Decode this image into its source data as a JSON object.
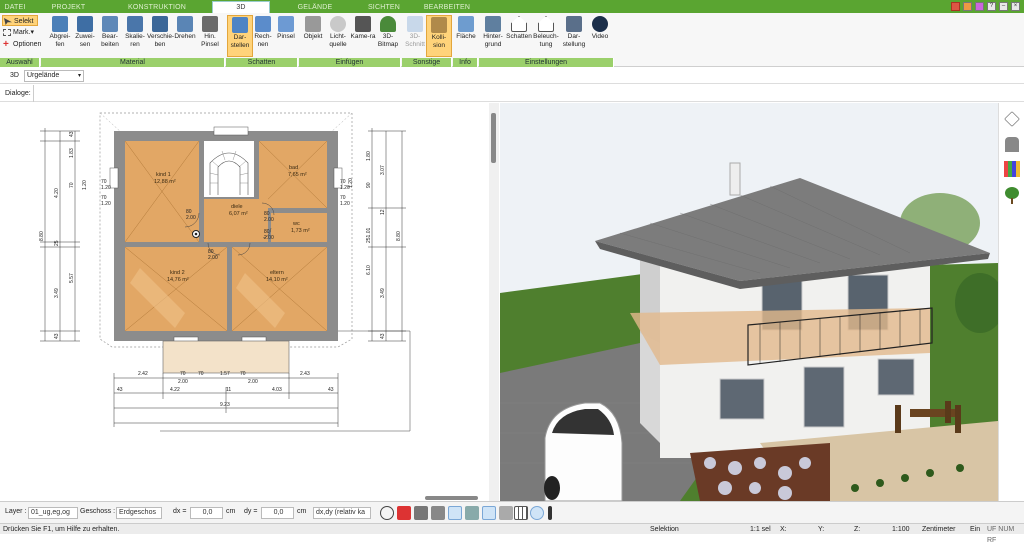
{
  "tabs": [
    {
      "label": "DATEI",
      "active": false
    },
    {
      "label": "PROJEKT",
      "active": false
    },
    {
      "label": "KONSTRUKTION",
      "active": false
    },
    {
      "label": "3D",
      "active": true
    },
    {
      "label": "GELÄNDE",
      "active": false
    },
    {
      "label": "SICHTEN",
      "active": false
    },
    {
      "label": "BEARBEITEN",
      "active": false
    }
  ],
  "ribbon": {
    "auswahl": {
      "label": "Auswahl",
      "selekt": "Selekt",
      "mark": "Mark.",
      "optionen": "Optionen"
    },
    "material": {
      "label": "Material",
      "buttons": [
        "Abgrei-fen",
        "Zuwei-sen",
        "Bear-beiten",
        "Skalie-ren",
        "Verschie-ben",
        "Drehen",
        "Hin. Pinsel"
      ]
    },
    "schatten": {
      "label": "Schatten",
      "buttons": [
        "Dar-stellen",
        "Rech-nen",
        "Pinsel"
      ]
    },
    "einfuegen": {
      "label": "Einfügen",
      "buttons": [
        "Objekt",
        "Licht-quelle",
        "Kame-ra",
        "3D-Bitmap"
      ]
    },
    "sonstige": {
      "label": "Sonstige",
      "buttons": [
        "3D-Schnitt",
        "Kolli-sion"
      ]
    },
    "info": {
      "label": "Info",
      "buttons": [
        "Fläche"
      ]
    },
    "einstellungen": {
      "label": "Einstellungen",
      "buttons": [
        "Hinter-grund",
        "Schatten",
        "Beleuch-tung",
        "Dar-stellung",
        "Video"
      ]
    }
  },
  "view_row": {
    "label": "3D",
    "value": "Urgelände"
  },
  "dialog_row": {
    "label": "Dialoge:"
  },
  "plan": {
    "rooms": [
      {
        "name": "kind 1",
        "area": "12,88 m²"
      },
      {
        "name": "bad",
        "area": "7,65 m²"
      },
      {
        "name": "diele",
        "area": "6,07 m²"
      },
      {
        "name": "wc",
        "area": "1,73 m²"
      },
      {
        "name": "kind 2",
        "area": "14,76 m²"
      },
      {
        "name": "eltern",
        "area": "14,10 m²"
      }
    ],
    "dims_left": [
      "43",
      "1.83",
      "4.20",
      "70",
      "1.20",
      "25",
      "5.57",
      "3.49",
      "43",
      "8.80"
    ],
    "dims_right": [
      "1.80",
      "3.07",
      "90",
      "1.20",
      "12",
      "251.01",
      "6.10",
      "3.49",
      "43",
      "8.80"
    ],
    "dims_bottom": [
      "2.42",
      "70",
      "70",
      "1.57",
      "70",
      "2.00",
      "2.43",
      "2.00",
      "43",
      "4.22",
      "11",
      "4.03",
      "43",
      "9.23"
    ],
    "door_labels": [
      "80",
      "2.00",
      "80",
      "2.00",
      "80",
      "2.00",
      "80",
      "2.00"
    ],
    "window_labels": [
      "70",
      "1.20",
      "70",
      "1.20",
      "70",
      "1.20",
      "70",
      "1.20"
    ]
  },
  "bottom_toolbar": {
    "layer_label": "Layer :",
    "layer_value": "01_ug,eg,og",
    "geschoss_label": "Geschoss :",
    "geschoss_value": "Erdgeschos",
    "dx_label": "dx =",
    "dx_value": "0,0",
    "dx_unit": "cm",
    "dy_label": "dy =",
    "dy_value": "0,0",
    "dy_unit": "cm",
    "mode_value": "dx,dy (relativ ka"
  },
  "status": {
    "hint": "Drücken Sie F1, um Hilfe zu erhalten.",
    "mode": "Selektion",
    "scale": "1:1 sel",
    "x": "X:",
    "y": "Y:",
    "z": "Z:",
    "ratio": "1:100",
    "unit": "Zentimeter",
    "ein": "Ein",
    "flags": "UF NUM RF"
  },
  "colors": {
    "accent": "#5aa531",
    "group_label": "#9bd06b",
    "selected": "#ffd37a",
    "floor": "#e2a765",
    "wall": "#8c8c8c"
  }
}
